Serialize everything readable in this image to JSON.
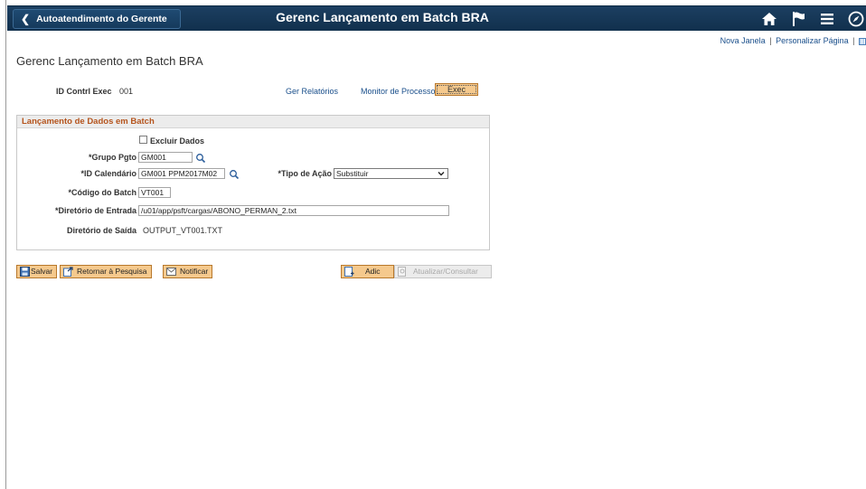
{
  "header": {
    "back_label": "Autoatendimento do Gerente",
    "title": "Gerenc Lançamento em Batch BRA",
    "icons": [
      "home-icon",
      "flag-icon",
      "menu-icon",
      "compass-icon"
    ]
  },
  "links": {
    "new_window": "Nova Janela",
    "separator": "|",
    "personalize": "Personalizar Página"
  },
  "page": {
    "title": "Gerenc Lançamento em Batch BRA",
    "run_control_label": "ID Contrl Exec",
    "run_control_value": "001",
    "report_manager": "Ger Relatórios",
    "process_monitor": "Monitor de Processos",
    "run_button": "Exec"
  },
  "group": {
    "title": "Lançamento de Dados em Batch",
    "delete_data_label": "Excluir Dados",
    "pay_group_label": "*Grupo Pgto",
    "pay_group_value": "GM001",
    "calendar_id_label": "*ID Calendário",
    "calendar_id_value": "GM001 PPM2017M02",
    "action_type_label": "*Tipo de Ação",
    "action_type_value": "Substituir",
    "batch_code_label": "*Código do Batch",
    "batch_code_value": "VT001",
    "input_dir_label": "*Diretório de Entrada",
    "input_dir_value": "/u01/app/psft/cargas/ABONO_PERMAN_2.txt",
    "output_dir_label": "Diretório de Saída",
    "output_dir_value": "OUTPUT_VT001.TXT"
  },
  "toolbar": {
    "save": "Salvar",
    "return_to_search": "Retornar à Pesquisa",
    "notify": "Notificar",
    "add": "Adic",
    "update_display": "Atualizar/Consultar"
  },
  "colors": {
    "topbar": "#153a5c",
    "button_fill": "#f5c98d",
    "group_title": "#b5541d",
    "link": "#1a4f8b"
  }
}
